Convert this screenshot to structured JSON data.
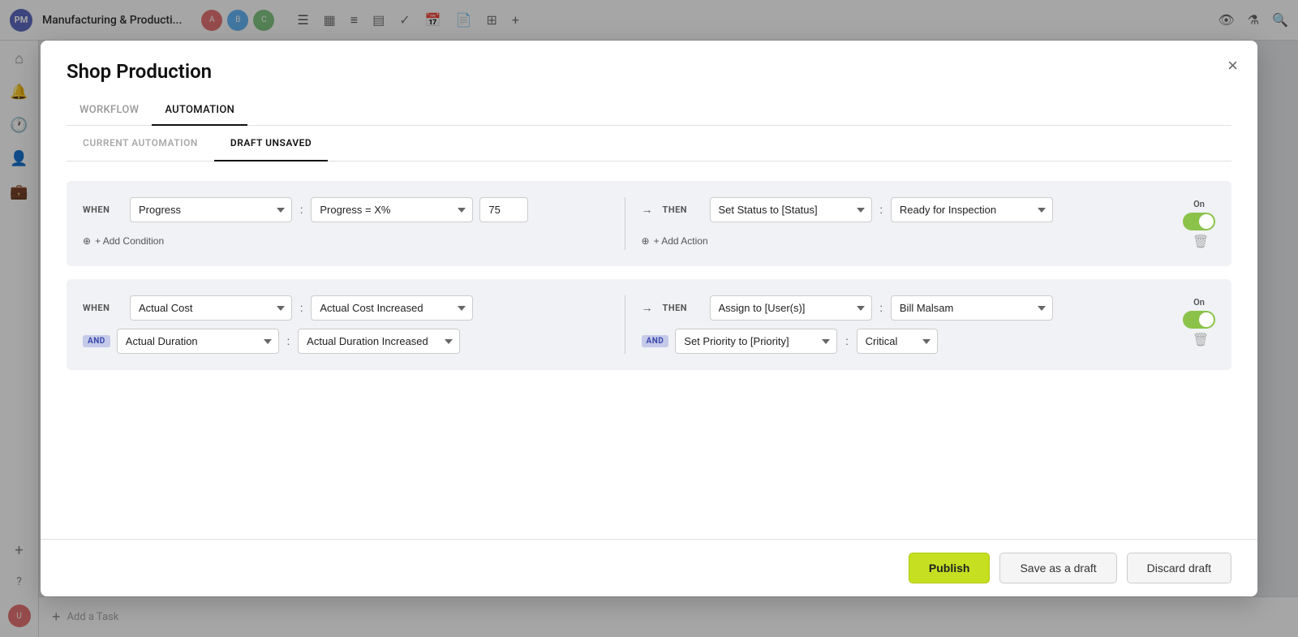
{
  "app": {
    "pm_label": "PM",
    "title": "Manufacturing & Producti...",
    "sidebar_icons": [
      "home",
      "bell",
      "clock",
      "user",
      "briefcase"
    ]
  },
  "modal": {
    "title": "Shop Production",
    "close_label": "×",
    "tabs": [
      {
        "id": "workflow",
        "label": "WORKFLOW",
        "active": false
      },
      {
        "id": "automation",
        "label": "AUTOMATION",
        "active": true
      }
    ],
    "sub_tabs": [
      {
        "id": "current",
        "label": "CURRENT AUTOMATION",
        "active": false
      },
      {
        "id": "draft",
        "label": "DRAFT UNSAVED",
        "active": true
      }
    ]
  },
  "rules": [
    {
      "id": "rule1",
      "when_label": "WHEN",
      "then_label": "THEN",
      "arrow": "→",
      "when_field": "Progress",
      "when_condition": "Progress = X%",
      "when_value": "75",
      "then_action": "Set Status to [Status]",
      "then_colon": ":",
      "then_value": "Ready for Inspection",
      "add_condition_label": "+ Add Condition",
      "add_action_label": "+ Add Action",
      "toggle_label": "On",
      "toggle_on": true
    },
    {
      "id": "rule2",
      "when_label": "WHEN",
      "then_label": "THEN",
      "arrow": "→",
      "when_field1": "Actual Cost",
      "when_condition1": "Actual Cost Increased",
      "and_badge1": "AND",
      "when_field2": "Actual Duration",
      "when_condition2": "Actual Duration Increased",
      "then_action1": "Assign to [User(s)]",
      "then_colon1": ":",
      "then_value1": "Bill Malsam",
      "and_badge2": "AND",
      "then_action2": "Set Priority to [Priority]",
      "then_colon2": ":",
      "then_value2": "Critical",
      "toggle_label": "On",
      "toggle_on": true
    }
  ],
  "footer": {
    "publish_label": "Publish",
    "draft_label": "Save as a draft",
    "discard_label": "Discard draft"
  }
}
